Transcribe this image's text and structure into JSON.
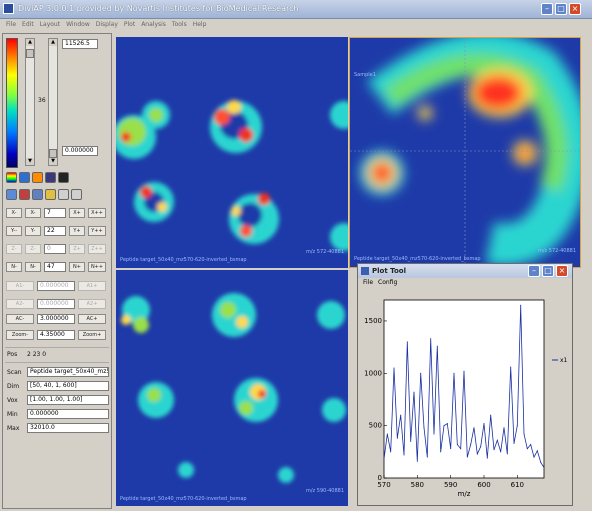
{
  "window": {
    "title": "DiviAP 3.0.0.1 provided by Novartis Institutes for BioMedical Research",
    "menu": [
      "File",
      "Edit",
      "Layout",
      "Window",
      "Display",
      "Plot",
      "Analysis",
      "Tools",
      "Help"
    ]
  },
  "left_panel": {
    "max_value": "11526.5",
    "min_value": "0.000000",
    "slider_value": "36",
    "row_x": {
      "minus": "X-",
      "minus2": "X-",
      "value": "7",
      "plus": "X+",
      "plus2": "X++"
    },
    "row_y": {
      "minus": "Y--",
      "minus2": "Y-",
      "value": "22",
      "plus": "Y+",
      "plus2": "Y++"
    },
    "row_z": {
      "minus": "Z-",
      "minus2": "Z-",
      "value": "0",
      "plus": "Z+",
      "plus2": "Z++"
    },
    "row_n": {
      "minus": "N-",
      "minus2": "N-",
      "value": "47",
      "plus": "N+",
      "plus2": "N++"
    },
    "row_a1": {
      "minus": "A1-",
      "value": "0.000000",
      "plus": "A1+"
    },
    "row_a2": {
      "minus": "A2-",
      "value": "0.000000",
      "plus": "A2+"
    },
    "row_ac": {
      "minus": "AC-",
      "value": "3.000000",
      "plus": "AC+"
    },
    "row_zoom": {
      "minus": "Zoom-",
      "value": "4.35000",
      "plus": "Zoom+"
    },
    "pos_label": "Pos",
    "pos_value": "2 23 0",
    "scan_label": "Scan",
    "scan_value": "Peptide target_50x40_mz570-62l",
    "dim_label": "Dim",
    "dim_value": "[50, 40, 1, 600]",
    "vox_label": "Vox",
    "vox_value": "[1.00, 1.00, 1.00]",
    "min_label": "Min",
    "min_value_b": "0.000000",
    "max_label": "Max",
    "max_value_b": "32010.0"
  },
  "views": {
    "top_left_caption": "Peptide target_50x40_mz570-620-inverted_bsmap",
    "top_left_mz": "m/z 572-40881",
    "top_right_caption": "Peptide target_50x40_mz570-620-inverted_bsmap",
    "top_right_mz": "m/z 572-40881",
    "top_right_sample": "Sample1",
    "bottom_left_caption": "Peptide target_50x40_mz570-620-inverted_bsmap",
    "bottom_left_mz": "m/z 590-40881"
  },
  "plot_tool": {
    "title": "Plot Tool",
    "menu": [
      "File",
      "Config"
    ],
    "legend": "x1",
    "colors": {
      "line": "#1a2fa0",
      "axes": "#000000",
      "bg": "#ffffff"
    },
    "chart_data": {
      "type": "line",
      "xlabel": "m/z",
      "ylabel": "",
      "xlim": [
        570,
        618
      ],
      "ylim": [
        0,
        1700
      ],
      "xticks": [
        570,
        580,
        590,
        600,
        610
      ],
      "yticks": [
        0,
        500,
        1000,
        1500
      ],
      "series": [
        {
          "name": "x1",
          "x": [
            570,
            571,
            572,
            573,
            574,
            575,
            576,
            577,
            578,
            579,
            580,
            581,
            582,
            583,
            584,
            585,
            586,
            587,
            588,
            589,
            590,
            591,
            592,
            593,
            594,
            595,
            596,
            597,
            598,
            599,
            600,
            601,
            602,
            603,
            604,
            605,
            606,
            607,
            608,
            609,
            610,
            611,
            612,
            613,
            614,
            615,
            616,
            617,
            618
          ],
          "y": [
            180,
            420,
            250,
            1050,
            380,
            600,
            220,
            1300,
            350,
            820,
            160,
            1000,
            480,
            200,
            1330,
            420,
            1260,
            250,
            500,
            520,
            280,
            1000,
            320,
            280,
            1020,
            200,
            320,
            480,
            230,
            300,
            520,
            190,
            600,
            270,
            360,
            250,
            480,
            230,
            1060,
            330,
            500,
            1650,
            420,
            280,
            320,
            200,
            260,
            150,
            100
          ]
        }
      ]
    }
  }
}
